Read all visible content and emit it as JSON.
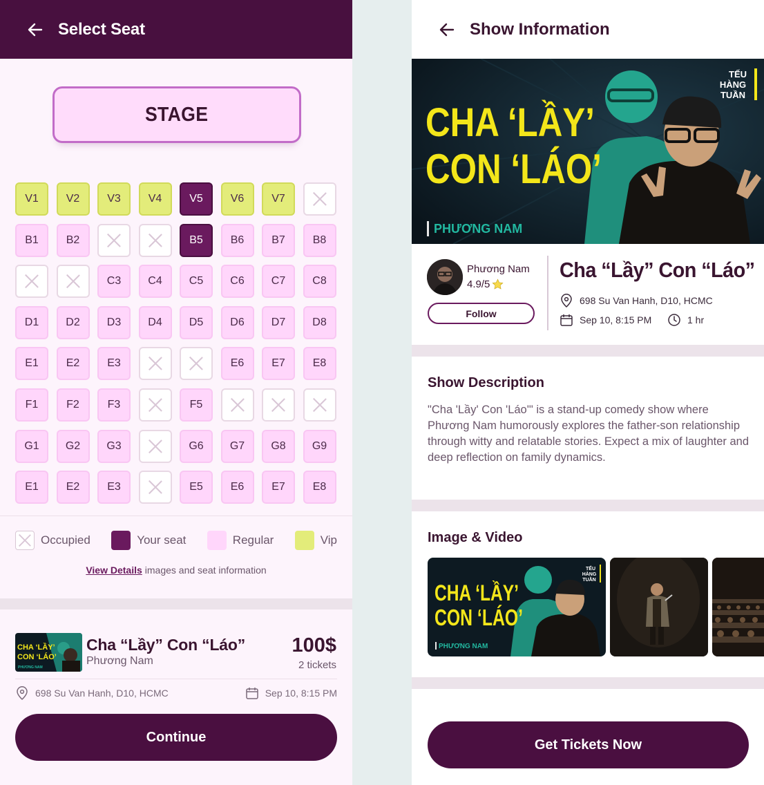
{
  "left": {
    "title": "Select Seat",
    "stage_label": "STAGE",
    "seats": [
      [
        {
          "label": "V1",
          "state": "vip"
        },
        {
          "label": "V2",
          "state": "vip"
        },
        {
          "label": "V3",
          "state": "vip"
        },
        {
          "label": "V4",
          "state": "vip"
        },
        {
          "label": "V5",
          "state": "mine"
        },
        {
          "label": "V6",
          "state": "vip"
        },
        {
          "label": "V7",
          "state": "vip"
        },
        {
          "label": "",
          "state": "occupied"
        }
      ],
      [
        {
          "label": "B1",
          "state": "regular"
        },
        {
          "label": "B2",
          "state": "regular"
        },
        {
          "label": "",
          "state": "occupied"
        },
        {
          "label": "",
          "state": "occupied"
        },
        {
          "label": "B5",
          "state": "mine"
        },
        {
          "label": "B6",
          "state": "regular"
        },
        {
          "label": "B7",
          "state": "regular"
        },
        {
          "label": "B8",
          "state": "regular"
        }
      ],
      [
        {
          "label": "",
          "state": "occupied"
        },
        {
          "label": "",
          "state": "occupied"
        },
        {
          "label": "C3",
          "state": "regular"
        },
        {
          "label": "C4",
          "state": "regular"
        },
        {
          "label": "C5",
          "state": "regular"
        },
        {
          "label": "C6",
          "state": "regular"
        },
        {
          "label": "C7",
          "state": "regular"
        },
        {
          "label": "C8",
          "state": "regular"
        }
      ],
      [
        {
          "label": "D1",
          "state": "regular"
        },
        {
          "label": "D2",
          "state": "regular"
        },
        {
          "label": "D3",
          "state": "regular"
        },
        {
          "label": "D4",
          "state": "regular"
        },
        {
          "label": "D5",
          "state": "regular"
        },
        {
          "label": "D6",
          "state": "regular"
        },
        {
          "label": "D7",
          "state": "regular"
        },
        {
          "label": "D8",
          "state": "regular"
        }
      ],
      [
        {
          "label": "E1",
          "state": "regular"
        },
        {
          "label": "E2",
          "state": "regular"
        },
        {
          "label": "E3",
          "state": "regular"
        },
        {
          "label": "",
          "state": "occupied"
        },
        {
          "label": "",
          "state": "occupied"
        },
        {
          "label": "E6",
          "state": "regular"
        },
        {
          "label": "E7",
          "state": "regular"
        },
        {
          "label": "E8",
          "state": "regular"
        }
      ],
      [
        {
          "label": "F1",
          "state": "regular"
        },
        {
          "label": "F2",
          "state": "regular"
        },
        {
          "label": "F3",
          "state": "regular"
        },
        {
          "label": "",
          "state": "occupied"
        },
        {
          "label": "F5",
          "state": "regular"
        },
        {
          "label": "",
          "state": "occupied"
        },
        {
          "label": "",
          "state": "occupied"
        },
        {
          "label": "",
          "state": "occupied"
        }
      ],
      [
        {
          "label": "G1",
          "state": "regular"
        },
        {
          "label": "G2",
          "state": "regular"
        },
        {
          "label": "G3",
          "state": "regular"
        },
        {
          "label": "",
          "state": "occupied"
        },
        {
          "label": "G6",
          "state": "regular"
        },
        {
          "label": "G7",
          "state": "regular"
        },
        {
          "label": "G8",
          "state": "regular"
        },
        {
          "label": "G9",
          "state": "regular"
        }
      ],
      [
        {
          "label": "E1",
          "state": "regular"
        },
        {
          "label": "E2",
          "state": "regular"
        },
        {
          "label": "E3",
          "state": "regular"
        },
        {
          "label": "",
          "state": "occupied"
        },
        {
          "label": "E5",
          "state": "regular"
        },
        {
          "label": "E6",
          "state": "regular"
        },
        {
          "label": "E7",
          "state": "regular"
        },
        {
          "label": "E8",
          "state": "regular"
        }
      ]
    ],
    "legend": {
      "occupied": "Occupied",
      "your_seat": "Your seat",
      "regular": "Regular",
      "vip": "Vip"
    },
    "details_link": "View Details",
    "details_text": "images and seat information",
    "ticket": {
      "title": "Cha “Lầy” Con “Láo”",
      "performer": "Phương Nam",
      "price": "100$",
      "count": "2 tickets",
      "address": "698 Su Van Hanh, D10, HCMC",
      "datetime": "Sep 10, 8:15 PM"
    },
    "continue_label": "Continue"
  },
  "right": {
    "title": "Show Information",
    "banner": {
      "line1": "CHA ‘LẦY’",
      "line2": "CON ‘LÁO’",
      "performer": "PHƯƠNG NAM",
      "brand": [
        "TẾU",
        "HÀNG",
        "TUẦN"
      ]
    },
    "host_name": "Phương Nam",
    "host_rating": "4.9/5",
    "follow_label": "Follow",
    "show_title": "Cha “Lầy” Con “Láo”",
    "address": "698 Su Van Hanh, D10, HCMC",
    "datetime": "Sep 10, 8:15 PM",
    "duration": "1 hr",
    "description_heading": "Show Description",
    "description": "\"Cha 'Lầy' Con 'Láo'\" is a stand-up comedy show where Phương Nam humorously explores the father-son relationship through witty and relatable stories. Expect a mix of laughter and deep reflection on family dynamics.",
    "media_heading": "Image & Video",
    "get_tickets_label": "Get Tickets Now"
  },
  "colors": {
    "primary": "#4a0f40",
    "your_seat": "#6a1a5e",
    "regular": "#ffd6fb",
    "vip": "#e3ec7a",
    "banner_text": "#f3e61a",
    "banner_teal": "#22b8a0"
  }
}
